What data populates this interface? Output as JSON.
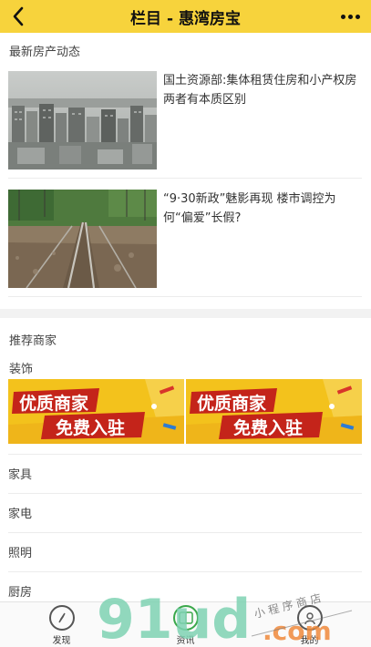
{
  "navbar": {
    "title": "栏目 - 惠湾房宝",
    "back_icon": "chevron-left-icon",
    "more_icon": "more-horizontal-icon",
    "background": "#f7d33c"
  },
  "news": {
    "section_title": "最新房产动态",
    "items": [
      {
        "title": "国土资源部:集体租赁住房和小产权房两者有本质区别"
      },
      {
        "title": "“9·30新政”魅影再现 楼市调控为何“偏爱”长假?"
      }
    ]
  },
  "merchants": {
    "section_title": "推荐商家",
    "featured_category": "装饰",
    "banner": {
      "line1": "优质商家",
      "line2": "免费入驻"
    },
    "categories": [
      "家具",
      "家电",
      "照明",
      "厨房"
    ]
  },
  "tabbar": {
    "items": [
      {
        "label": "发现",
        "icon": "compass-icon"
      },
      {
        "label": "资讯",
        "icon": "news-icon",
        "active": true
      },
      {
        "label": "我的",
        "icon": "user-icon"
      }
    ],
    "active_color": "#3aa84a"
  },
  "watermark": {
    "logo": "91ud",
    "suffix": ".com",
    "tagline": "小 程 序 商 店"
  }
}
